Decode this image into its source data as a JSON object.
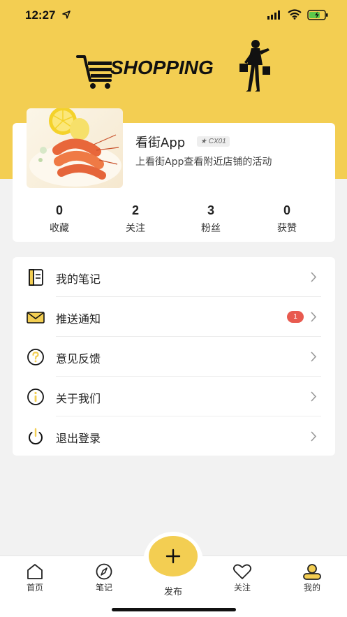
{
  "status_bar": {
    "time": "12:27"
  },
  "logo": {
    "text": "SHOPPING"
  },
  "profile": {
    "name": "看街App",
    "badge": "CX01",
    "subtitle": "上看街App查看附近店铺的活动",
    "stats": [
      {
        "value": "0",
        "label": "收藏"
      },
      {
        "value": "2",
        "label": "关注"
      },
      {
        "value": "3",
        "label": "粉丝"
      },
      {
        "value": "0",
        "label": "获赞"
      }
    ]
  },
  "menu": {
    "items": [
      {
        "label": "我的笔记",
        "icon": "notebook-icon"
      },
      {
        "label": "推送通知",
        "icon": "envelope-icon",
        "badge": "1"
      },
      {
        "label": "意见反馈",
        "icon": "question-icon"
      },
      {
        "label": "关于我们",
        "icon": "info-icon"
      },
      {
        "label": "退出登录",
        "icon": "power-icon"
      }
    ]
  },
  "tabbar": {
    "tabs": [
      {
        "label": "首页",
        "icon": "home-icon"
      },
      {
        "label": "笔记",
        "icon": "compass-icon"
      },
      {
        "label": "发布",
        "icon": "plus-icon"
      },
      {
        "label": "关注",
        "icon": "heart-icon"
      },
      {
        "label": "我的",
        "icon": "profile-icon"
      }
    ],
    "active": "我的"
  },
  "colors": {
    "accent": "#f3ce52",
    "badge": "#e85a4f",
    "background": "#f2f2f2"
  }
}
